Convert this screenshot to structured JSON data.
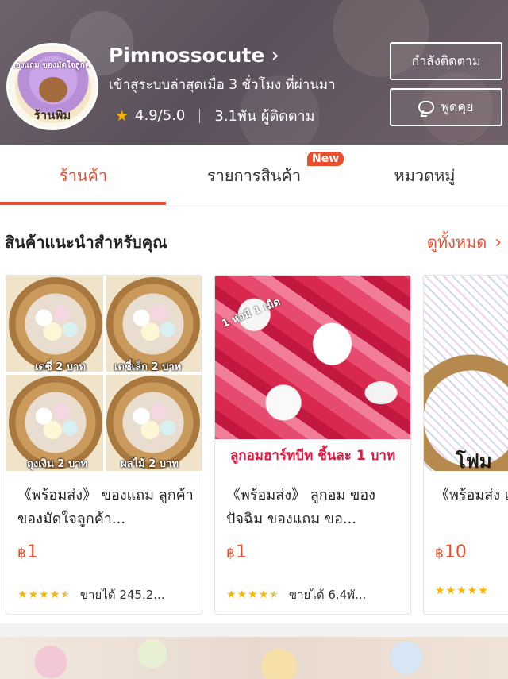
{
  "shop": {
    "name": "Pimnossocute",
    "last_active": "เข้าสู่ระบบล่าสุดเมื่อ 3 ชั่วโมง ที่ผ่านมา",
    "rating": "4.9/5.0",
    "followers": "3.1พัน ผู้ติดตาม",
    "avatar_text_top": "ของแถม ของมัดใจลูกค้า",
    "avatar_text_bottom": "ร้านพิม",
    "follow_button": "กำลังติดตาม",
    "chat_button": "พูดคุย"
  },
  "tabs": [
    {
      "label": "ร้านค้า",
      "active": true
    },
    {
      "label": "รายการสินค้า",
      "badge": "New"
    },
    {
      "label": "หมวดหมู่"
    }
  ],
  "section": {
    "title": "สินค้าแนะนำสำหรับคุณ",
    "see_all": "ดูทั้งหมด"
  },
  "products": [
    {
      "title": "《พร้อมส่ง》 ของแถม ลูกค้า ของมัดใจลูกค้า...",
      "currency": "฿",
      "price": "1",
      "rating_stars": 4.5,
      "sold": "ขายได้ 245.2...",
      "image_labels": [
        "เดซี่ 2 บาท",
        "เดซี่เล็ก 2 บาท",
        "ถุงเงิน 2 บาท",
        "ผลไม้ 2 บาท"
      ]
    },
    {
      "title": "《พร้อมส่ง》 ลูกอม ของปัจฉิม ของแถม ขอ...",
      "currency": "฿",
      "price": "1",
      "rating_stars": 4.5,
      "sold": "ขายได้ 6.4พั...",
      "image_tag": "1 ห่อมี 1 เม็ด",
      "image_banner": "ลูกอมฮาร์ทบีท ชิ้นละ 1 บาท"
    },
    {
      "title": "《พร้อมส่ง เทล โฟม เ",
      "currency": "฿",
      "price": "10",
      "rating_stars": 5,
      "image_label": "โฟม"
    }
  ],
  "colors": {
    "accent": "#ee4d2d",
    "star": "#f7b500"
  }
}
